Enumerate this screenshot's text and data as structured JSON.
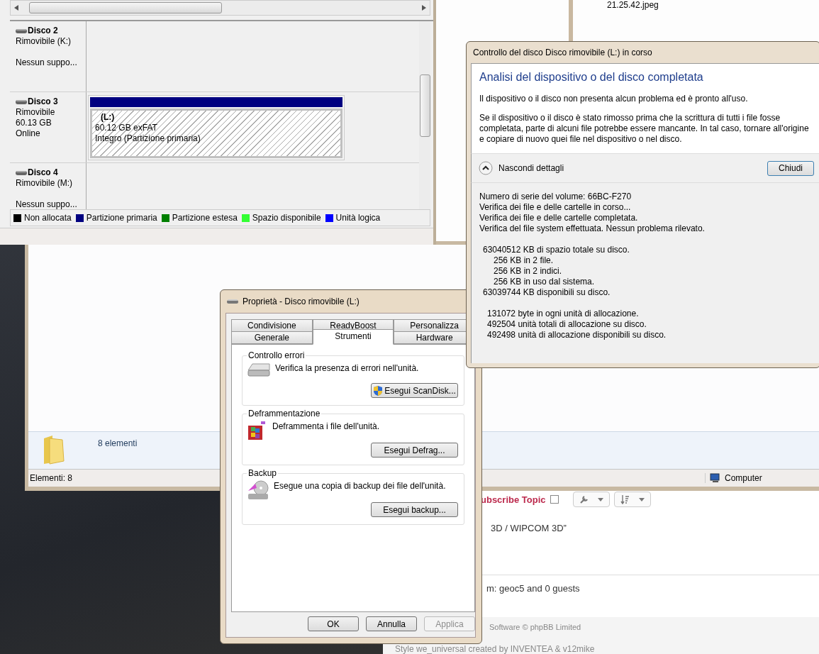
{
  "explorer_back": {
    "file_name": "21.25.42.jpeg"
  },
  "browser_page": {
    "subscribe_label": "ubscribe Topic",
    "subscribe_checked": false,
    "topic_title": "3D / WIPCOM 3D”",
    "online_text": "m: geoc5 and 0 guests",
    "footer_lines": [
      "Software © phpBB Limited",
      "Style we_universal created by INVENTEA & v12mike"
    ]
  },
  "disk_management": {
    "disks": [
      {
        "name": "Disco 2",
        "kind": "no_media",
        "lines": [
          "Rimovibile (K:)",
          "Nessun suppo..."
        ]
      },
      {
        "name": "Disco 3",
        "kind": "online",
        "lines": [
          "Rimovibile",
          "60.13 GB",
          "Online"
        ],
        "partition": {
          "label": "(L:)",
          "size": "60.12 GB exFAT",
          "status": "Integro (Partizione primaria)"
        }
      },
      {
        "name": "Disco 4",
        "kind": "no_media",
        "lines": [
          "Rimovibile (M:)",
          "Nessun suppo..."
        ]
      }
    ],
    "legend": [
      {
        "label": "Non allocata",
        "color": "#000000"
      },
      {
        "label": "Partizione primaria",
        "color": "#000080"
      },
      {
        "label": "Partizione estesa",
        "color": "#008000"
      },
      {
        "label": "Spazio disponibile",
        "color": "#33ff33"
      },
      {
        "label": "Unità logica",
        "color": "#0000ff"
      }
    ]
  },
  "explorer": {
    "details_count": "8 elementi",
    "status_left": "Elementi: 8",
    "status_right": "Computer"
  },
  "check_dialog": {
    "title": "Controllo del disco Disco rimovibile (L:) in corso",
    "heading": "Analisi del dispositivo o del disco completata",
    "paragraphs": [
      "Il dispositivo o il disco non presenta alcun problema ed è pronto all'uso.",
      "Se il dispositivo o il disco è stato rimosso prima che la scrittura di tutti i file fosse completata, parte di alcuni file potrebbe essere mancante. In tal caso, tornare all'origine e copiare di nuovo quei file nel dispositivo o nel disco."
    ],
    "details_toggle": "Nascondi dettagli",
    "details_expanded": true,
    "close_button": "Chiudi",
    "details": [
      {
        "lines": [
          {
            "text": "Numero di serie del volume: 66BC-F270"
          },
          {
            "text": "Verifica dei file e delle cartelle in corso..."
          },
          {
            "text": "Verifica dei file e delle cartelle completata."
          },
          {
            "text": "Verifica del file system effettuata.  Nessun problema rilevato."
          }
        ]
      },
      {
        "lines": [
          {
            "text": "63040512 KB di spazio totale su disco.",
            "children": [
              {
                "text": "256 KB in 2 file."
              },
              {
                "text": "256 KB in 2 indici."
              },
              {
                "text": "256 KB in uso dal sistema."
              }
            ]
          },
          {
            "text": "63039744 KB disponibili su disco."
          }
        ]
      },
      {
        "lines": [
          {
            "text": "131072 byte in ogni unità di allocazione."
          },
          {
            "text": "492504 unità totali di allocazione su disco."
          },
          {
            "text": "492498 unità di allocazione disponibili su disco."
          }
        ]
      }
    ]
  },
  "properties_dialog": {
    "title": "Proprietà - Disco rimovibile (L:)",
    "tab_rows": [
      [
        {
          "label": "Condivisione",
          "selected": false
        },
        {
          "label": "ReadyBoost",
          "selected": false
        },
        {
          "label": "Personalizza",
          "selected": false
        }
      ],
      [
        {
          "label": "Generale",
          "selected": false
        },
        {
          "label": "Strumenti",
          "selected": true
        },
        {
          "label": "Hardware",
          "selected": false
        }
      ]
    ],
    "sections": [
      {
        "title": "Controllo errori",
        "kind": "check",
        "description": "Verifica la presenza di errori nell'unità.",
        "button": "Esegui ScanDisk...",
        "button_shield": true
      },
      {
        "title": "Deframmentazione",
        "kind": "defrag",
        "description": "Deframmenta i file dell'unità.",
        "button": "Esegui Defrag...",
        "button_shield": false
      },
      {
        "title": "Backup",
        "kind": "backup",
        "description": "Esegue una copia di backup dei file dell'unità.",
        "button": "Esegui backup...",
        "button_shield": false
      }
    ],
    "buttons": [
      {
        "label": "OK",
        "disabled": false
      },
      {
        "label": "Annulla",
        "disabled": false
      },
      {
        "label": "Applica",
        "disabled": true
      }
    ]
  }
}
